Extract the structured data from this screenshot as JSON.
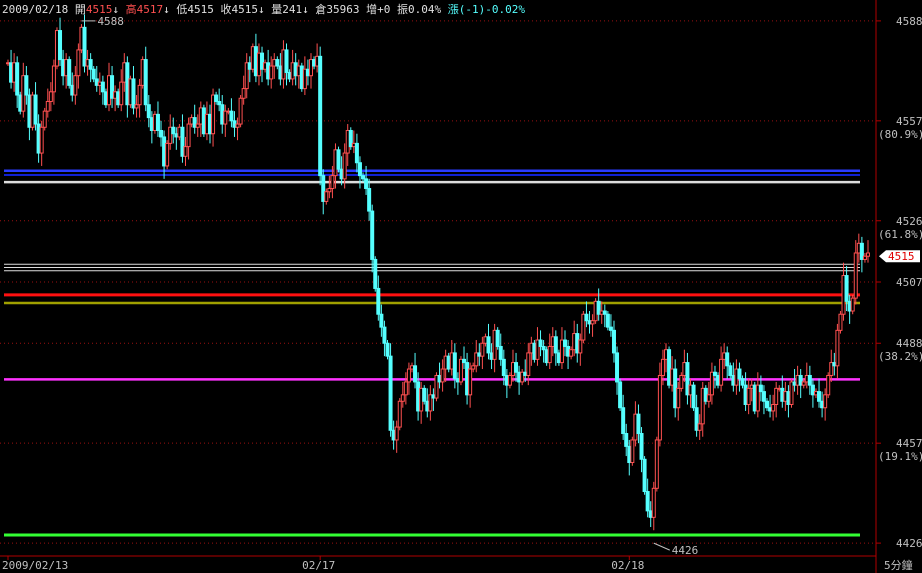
{
  "header": {
    "date": "2009/02/18",
    "open_label": "開",
    "open_value": "4515",
    "high_label": "高",
    "high_value": "4517",
    "low_label": "低",
    "low_value": "4515",
    "close_label": "收",
    "close_value": "4515",
    "volume_label": "量",
    "volume_value": "241",
    "oi_label": "倉",
    "oi_value": "35963",
    "oi_change": "增+0",
    "amplitude": "振0.04%",
    "change": "漲(-1)-0.02%",
    "arrow": "↓"
  },
  "colors": {
    "up": "#ff5050",
    "down": "#55ffff",
    "grid": "#9a1010",
    "axis": "#b00000",
    "tick_label": "#c0c0c0",
    "pct_label": "#c0c0c0",
    "current_price_bg": "#ffffff",
    "current_price_text": "#e00000"
  },
  "chart_data": {
    "type": "candlestick",
    "interval_label": "5分鐘",
    "ylim": [
      4422,
      4592
    ],
    "y_ticks": [
      {
        "value": 4588,
        "label": "4588"
      },
      {
        "value": 4557,
        "label": "4557",
        "pct": "(80.9%)"
      },
      {
        "value": 4526,
        "label": "4526",
        "pct": "(61.8%)"
      },
      {
        "value": 4507,
        "label": "4507"
      },
      {
        "value": 4488,
        "label": "4488",
        "pct": "(38.2%)"
      },
      {
        "value": 4457,
        "label": "4457",
        "pct": "(19.1%)"
      },
      {
        "value": 4426,
        "label": "4426"
      }
    ],
    "x_labels": [
      {
        "index": 0,
        "label": "2009/02/13"
      },
      {
        "index": 102,
        "label": "02/17"
      },
      {
        "index": 203,
        "label": "02/18"
      }
    ],
    "current_price": {
      "value": 4515,
      "label": "4515"
    },
    "high_annotation": {
      "index": 24,
      "value": 4588,
      "label": "4588"
    },
    "low_annotation": {
      "index": 211,
      "value": 4426,
      "label": "4426"
    },
    "levels": [
      {
        "value": 4541.5,
        "color": "#2a3cff",
        "width": 2.5
      },
      {
        "value": 4540.2,
        "color": "#1020d0",
        "width": 2
      },
      {
        "value": 4538,
        "color": "#dddddd",
        "width": 2.5
      },
      {
        "value": 4512.5,
        "color": "#dddddd",
        "width": 1
      },
      {
        "value": 4511.5,
        "color": "#dddddd",
        "width": 1
      },
      {
        "value": 4510.5,
        "color": "#dddddd",
        "width": 1
      },
      {
        "value": 4503,
        "color": "#ff1010",
        "width": 3
      },
      {
        "value": 4500.5,
        "color": "#a0a000",
        "width": 2.5
      },
      {
        "value": 4476.8,
        "color": "#ff33ff",
        "width": 2.5
      },
      {
        "value": 4428.5,
        "color": "#33ff33",
        "width": 3
      }
    ],
    "closes": [
      4575,
      4569,
      4575,
      4565,
      4560,
      4571,
      4565,
      4555,
      4565,
      4556,
      4547,
      4555,
      4560,
      4563,
      4566,
      4574,
      4585,
      4576,
      4571,
      4576,
      4568,
      4565,
      4571,
      4579,
      4586,
      4574,
      4576,
      4573,
      4570,
      4568,
      4569,
      4566,
      4562,
      4571,
      4564,
      4566,
      4562,
      4569,
      4575,
      4562,
      4570,
      4561,
      4562,
      4568,
      4576,
      4562,
      4558,
      4554,
      4559,
      4554,
      4552,
      4543,
      4550,
      4555,
      4553,
      4552,
      4555,
      4546,
      4549,
      4556,
      4558,
      4555,
      4556,
      4561,
      4553,
      4559,
      4553,
      4565,
      4563,
      4562,
      4556,
      4560,
      4560,
      4557,
      4555,
      4556,
      4564,
      4567,
      4575,
      4573,
      4580,
      4571,
      4578,
      4573,
      4575,
      4570,
      4574,
      4576,
      4574,
      4570,
      4579,
      4572,
      4570,
      4575,
      4571,
      4574,
      4567,
      4573,
      4571,
      4576,
      4574,
      4577,
      4540,
      4532,
      4535,
      4536,
      4540,
      4548,
      4542,
      4539,
      4547,
      4554,
      4549,
      4550,
      4544,
      4540,
      4539,
      4536,
      4529,
      4514,
      4505,
      4497,
      4493,
      4488,
      4484,
      4461,
      4458,
      4462,
      4470,
      4472,
      4476,
      4480,
      4481,
      4476,
      4467,
      4474,
      4470,
      4467,
      4472,
      4471,
      4478,
      4476,
      4480,
      4484,
      4480,
      4485,
      4477,
      4476,
      4483,
      4482,
      4472,
      4480,
      4481,
      4485,
      4484,
      4488,
      4490,
      4485,
      4483,
      4492,
      4487,
      4483,
      4478,
      4475,
      4478,
      4482,
      4479,
      4476,
      4479,
      4478,
      4485,
      4488,
      4483,
      4489,
      4487,
      4486,
      4482,
      4487,
      4490,
      4485,
      4482,
      4489,
      4487,
      4484,
      4486,
      4491,
      4485,
      4489,
      4497,
      4495,
      4494,
      4495,
      4501,
      4497,
      4498,
      4497,
      4493,
      4492,
      4485,
      4476,
      4468,
      4460,
      4456,
      4451,
      4458,
      4466,
      4460,
      4452,
      4442,
      4436,
      4434,
      4443,
      4458,
      4478,
      4483,
      4486,
      4475,
      4480,
      4468,
      4474,
      4478,
      4482,
      4472,
      4475,
      4468,
      4461,
      4463,
      4474,
      4470,
      4472,
      4479,
      4478,
      4475,
      4483,
      4485,
      4481,
      4478,
      4475,
      4480,
      4477,
      4475,
      4469,
      4474,
      4475,
      4467,
      4475,
      4473,
      4470,
      4468,
      4467,
      4469,
      4474,
      4474,
      4470,
      4473,
      4469,
      4476,
      4475,
      4478,
      4475,
      4476,
      4478,
      4475,
      4472,
      4473,
      4470,
      4468,
      4472,
      4478,
      4482,
      4481,
      4492,
      4497,
      4509,
      4501,
      4498,
      4502,
      4516,
      4519,
      4514,
      4515,
      4516
    ]
  }
}
